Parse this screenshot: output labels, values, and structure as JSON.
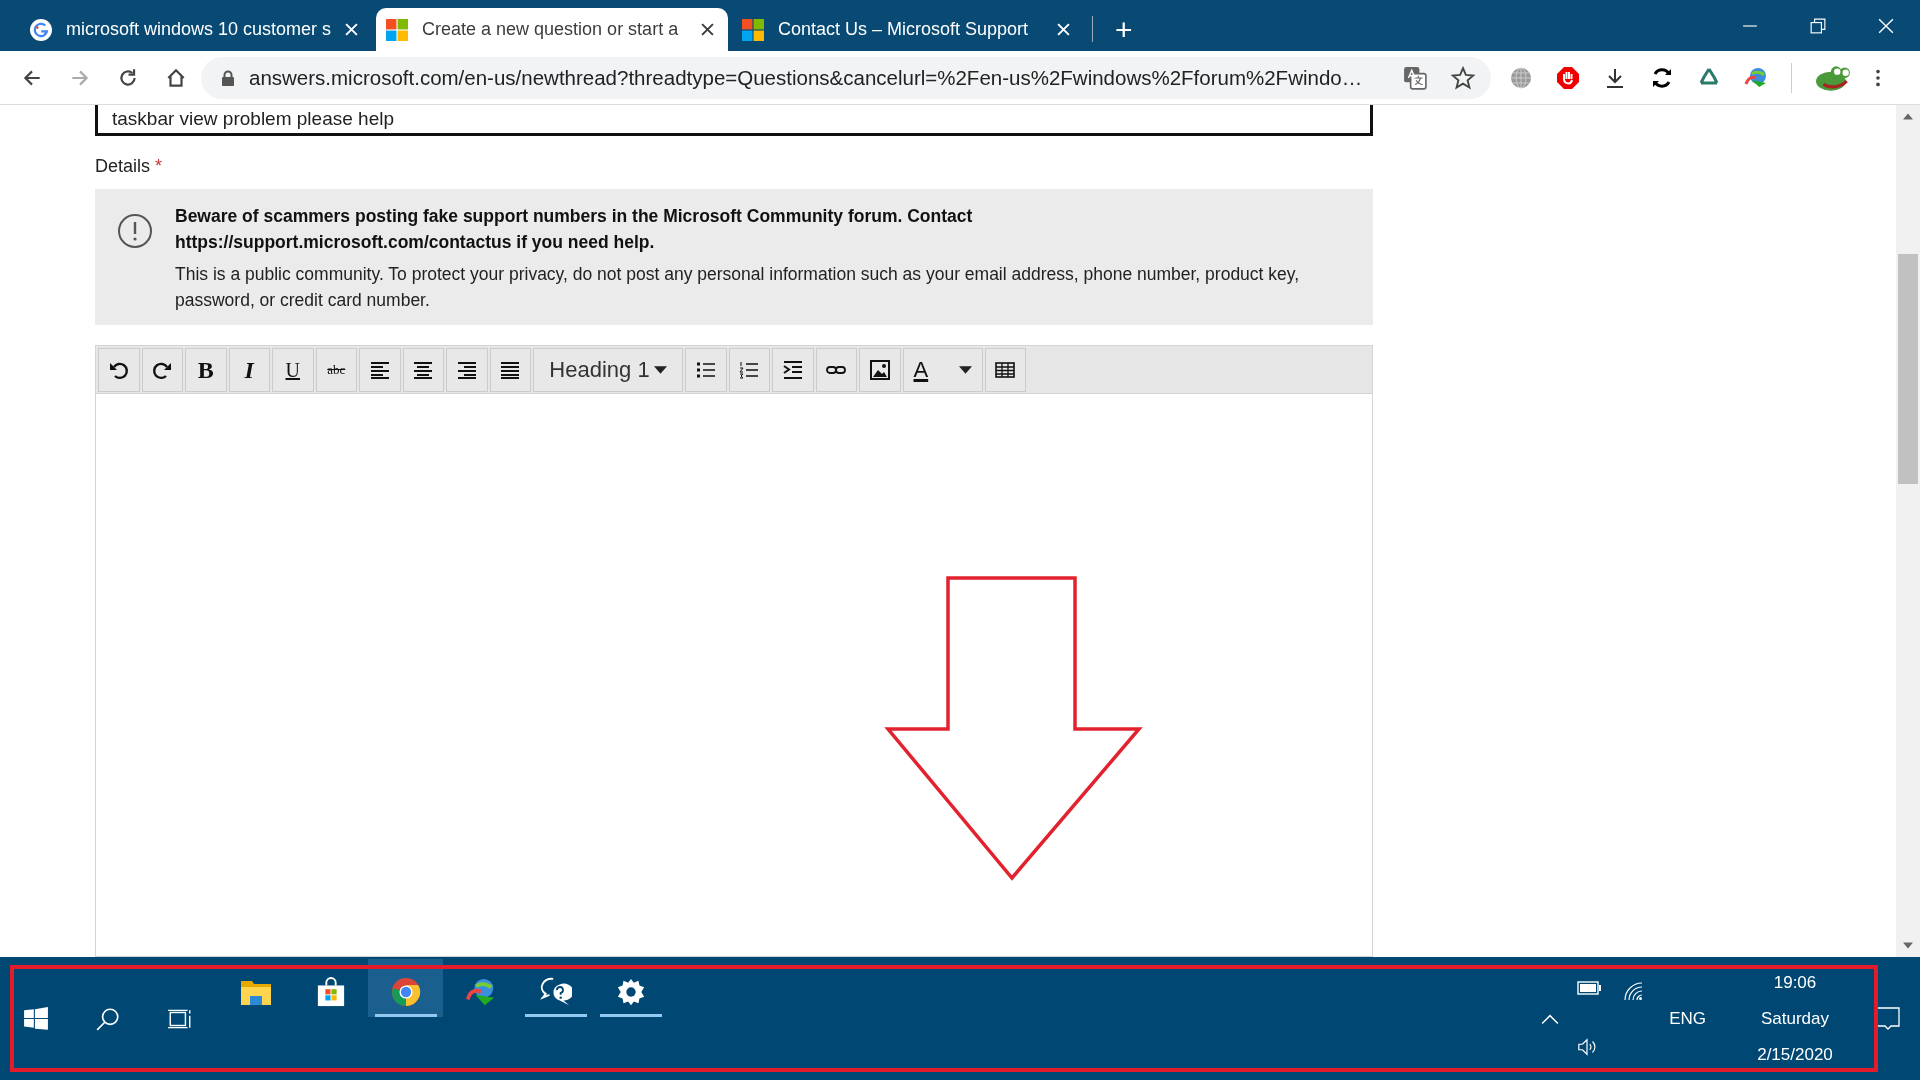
{
  "browser": {
    "tabs": [
      {
        "title": "microsoft windows 10 customer s",
        "selected": false
      },
      {
        "title": "Create a new question or start a",
        "selected": true
      },
      {
        "title": "Contact Us – Microsoft Support",
        "selected": false
      }
    ],
    "new_tab": "+",
    "address": "answers.microsoft.com/en-us/newthread?threadtype=Questions&cancelurl=%2Fen-us%2Fwindows%2Fforum%2Fwindo…"
  },
  "form": {
    "subject": "taskbar view problem please help",
    "details_label": "Details",
    "required_mark": "*",
    "notice_warning": "Beware of scammers posting fake support numbers in the Microsoft Community forum. Contact https://support.microsoft.com/contactus if you need help.",
    "notice_privacy": "This is a public community. To protect your privacy, do not post any personal information such as your email address, phone number, product key, password, or credit card number.",
    "toolbar": [
      {
        "kind": "undo"
      },
      {
        "kind": "redo"
      },
      {
        "kind": "bold",
        "label": "B"
      },
      {
        "kind": "italic",
        "label": "I"
      },
      {
        "kind": "underline",
        "label": "U"
      },
      {
        "kind": "strike",
        "label": "abc"
      },
      {
        "kind": "align-left"
      },
      {
        "kind": "align-center"
      },
      {
        "kind": "align-right"
      },
      {
        "kind": "justify"
      },
      {
        "kind": "format",
        "label": "Heading 1"
      },
      {
        "kind": "bullets"
      },
      {
        "kind": "numbers"
      },
      {
        "kind": "indent"
      },
      {
        "kind": "link"
      },
      {
        "kind": "image"
      },
      {
        "kind": "font-color",
        "label": "A"
      },
      {
        "kind": "table"
      }
    ]
  },
  "taskbar": {
    "apps": [
      {
        "running": false,
        "selected": false
      },
      {
        "running": false,
        "selected": false
      },
      {
        "running": true,
        "selected": true
      },
      {
        "running": false,
        "selected": false
      },
      {
        "running": true,
        "selected": false
      },
      {
        "running": true,
        "selected": false
      }
    ],
    "language": "ENG",
    "time": "19:06",
    "day": "Saturday",
    "date": "2/15/2020"
  }
}
